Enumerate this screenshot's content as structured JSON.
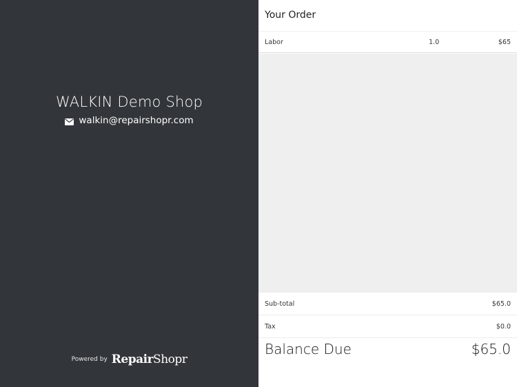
{
  "shop": {
    "name": "WALKIN Demo Shop",
    "email": "walkin@repairshopr.com",
    "email_icon": "envelope-icon"
  },
  "footer": {
    "powered_label": "Powered by",
    "brand_bold": "Repair",
    "brand_light": "Shopr"
  },
  "order": {
    "title": "Your Order",
    "items": [
      {
        "name": "Labor",
        "qty": "1.0",
        "price": "$65"
      }
    ],
    "subtotal_label": "Sub-total",
    "subtotal_value": "$65.0",
    "tax_label": "Tax",
    "tax_value": "$0.0",
    "balance_label": "Balance Due",
    "balance_value": "$65.0"
  },
  "colors": {
    "left_panel_bg": "#32363a",
    "order_empty_bg": "#efefef"
  }
}
